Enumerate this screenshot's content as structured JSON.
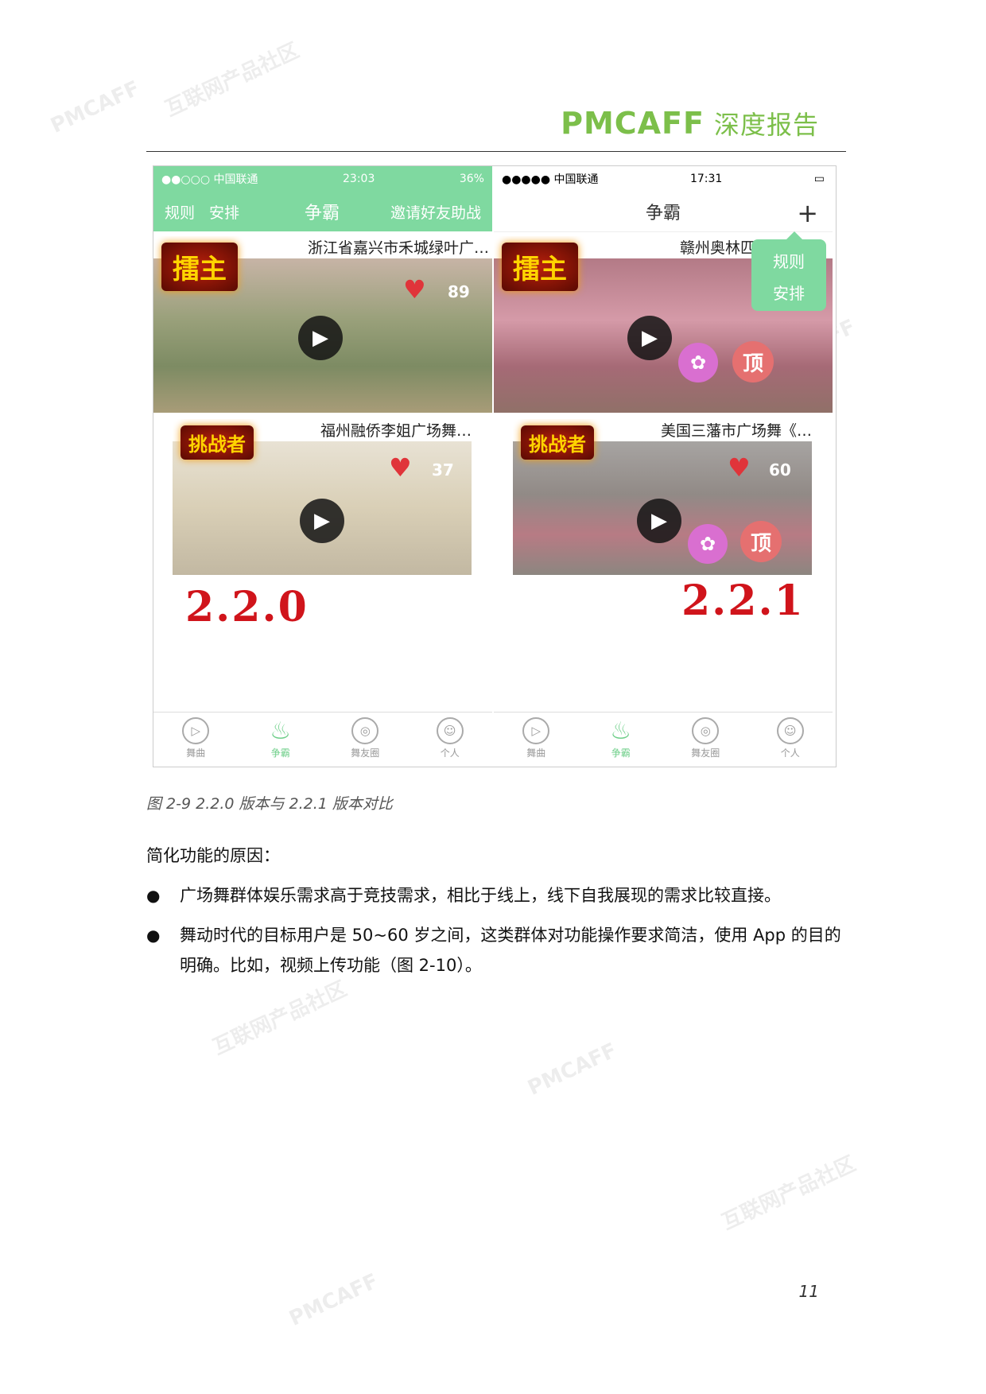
{
  "watermarks": [
    "PMCAFF",
    "互联网产品社区"
  ],
  "header": {
    "brand": "PMCAFF",
    "subtitle": "深度报告"
  },
  "screenshot": {
    "left_phone": {
      "status": {
        "signal": "●●○○○ 中国联通",
        "time": "23:03",
        "battery": "36%"
      },
      "nav": {
        "rules": "规则",
        "schedule": "安排",
        "title": "争霸",
        "invite": "邀请好友助战"
      },
      "cards": [
        {
          "title": "浙江省嘉兴市禾城绿叶广…",
          "badge": "擂主",
          "likes": "89"
        },
        {
          "title": "福州融侨李姐广场舞…",
          "badge": "挑战者",
          "likes": "37"
        }
      ],
      "version": "2.2.0",
      "tabs": [
        "舞曲",
        "争霸",
        "舞友圈",
        "个人"
      ]
    },
    "right_phone": {
      "status": {
        "signal": "●●●●● 中国联通",
        "time": "17:31"
      },
      "nav": {
        "title": "争霸",
        "plus": "+"
      },
      "popover": [
        "规则",
        "安排"
      ],
      "cards": [
        {
          "title": "赣州奥林匹克广…",
          "badge": "擂主",
          "ding": "顶"
        },
        {
          "title": "美国三藩市广场舞《…",
          "badge": "挑战者",
          "likes": "60",
          "ding": "顶"
        }
      ],
      "version": "2.2.1",
      "tabs": [
        "舞曲",
        "争霸",
        "舞友圈",
        "个人"
      ]
    }
  },
  "caption": "图 2-9 2.2.0 版本与 2.2.1 版本对比",
  "section_title": "简化功能的原因：",
  "bullets": [
    "广场舞群体娱乐需求高于竞技需求，相比于线上，线下自我展现的需求比较直接。",
    "舞动时代的目标用户是 50~60 岁之间，这类群体对功能操作要求简洁，使用 App 的目的明确。比如，视频上传功能（图 2-10）。"
  ],
  "page_number": "11",
  "colors": {
    "brand_green": "#7cbf4a",
    "app_green": "#7fd9a0",
    "heart_red": "#e0343a",
    "version_red": "#d0141b"
  }
}
